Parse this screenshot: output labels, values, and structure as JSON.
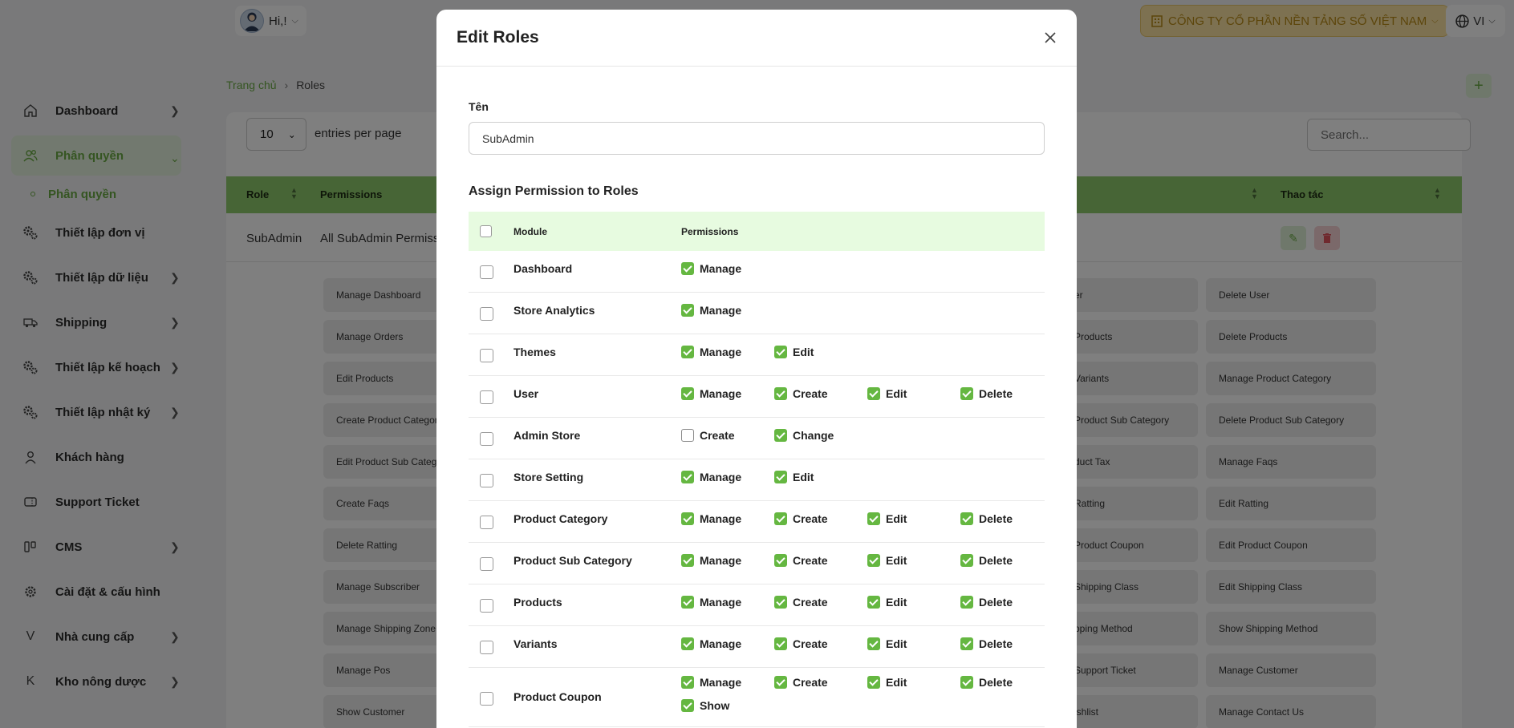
{
  "topbar": {
    "greeting": "Hi,!",
    "company": "CÔNG TY CỔ PHẦN NỀN TẢNG SỐ VIỆT NAM",
    "language": "VI"
  },
  "sidebar": {
    "items": [
      {
        "label": "Dashboard",
        "icon": "home-icon",
        "chevron": true
      },
      {
        "label": "Phân quyền",
        "icon": "users-icon",
        "chevron": true,
        "active": true
      },
      {
        "label": "Thiết lập đơn vị",
        "icon": "gears-icon",
        "chevron": false
      },
      {
        "label": "Thiết lập dữ liệu",
        "icon": "gears-icon",
        "chevron": true
      },
      {
        "label": "Shipping",
        "icon": "truck-icon",
        "chevron": true
      },
      {
        "label": "Thiết lập kế hoạch",
        "icon": "gears-icon",
        "chevron": true
      },
      {
        "label": "Thiết lập nhật ký",
        "icon": "gears-icon",
        "chevron": true
      },
      {
        "label": "Khách hàng",
        "icon": "user-icon",
        "chevron": false
      },
      {
        "label": "Support Ticket",
        "icon": "ticket-icon",
        "chevron": false
      },
      {
        "label": "CMS",
        "icon": "cms-icon",
        "chevron": true
      },
      {
        "label": "Cài đặt & cấu hình",
        "icon": "gear-icon",
        "chevron": false
      },
      {
        "label": "Nhà cung cấp",
        "icon": "v-icon",
        "chevron": true
      },
      {
        "label": "Kho nông dược",
        "icon": "k-icon",
        "chevron": true
      }
    ],
    "sub_item": "Phân quyền"
  },
  "breadcrumb": {
    "home": "Trang chủ",
    "sep": "›",
    "current": "Roles"
  },
  "list": {
    "entries_value": "10",
    "entries_label": "entries per page",
    "search_placeholder": "Search...",
    "headers": {
      "role": "Role",
      "permissions": "Permissions",
      "actions": "Thao tác"
    },
    "row": {
      "role": "SubAdmin",
      "permissions": "All SubAdmin Permissio"
    },
    "chips_left": [
      "Manage Dashboard",
      "Manage Orders",
      "Edit Products",
      "Create Product Categor",
      "Edit Product Sub Categ",
      "Create Faqs",
      "Delete Ratting",
      "Manage Subscriber",
      "Manage Shipping Zone",
      "Manage Pos",
      "Show Customer"
    ],
    "chips_mid": [
      "er",
      "Products",
      "Variants",
      "Product Sub Category",
      "duct Tax",
      "Ratting",
      "Product Coupon",
      "Shipping Class",
      "pping Method",
      "Support Ticket",
      "ishlist"
    ],
    "chips_right": [
      "Delete User",
      "Delete Products",
      "Manage Product Category",
      "Delete Product Sub Category",
      "Manage Faqs",
      "Edit Ratting",
      "Edit Product Coupon",
      "Edit Shipping Class",
      "Show Shipping Method",
      "Manage Customer",
      "Manage Contact Us"
    ]
  },
  "modal": {
    "title": "Edit Roles",
    "name_label": "Tên",
    "name_value": "SubAdmin",
    "section_title": "Assign Permission to Roles",
    "col_module": "Module",
    "col_permissions": "Permissions",
    "rows": [
      {
        "module": "Dashboard",
        "perms": [
          {
            "label": "Manage",
            "checked": true
          }
        ]
      },
      {
        "module": "Store Analytics",
        "perms": [
          {
            "label": "Manage",
            "checked": true
          }
        ]
      },
      {
        "module": "Themes",
        "perms": [
          {
            "label": "Manage",
            "checked": true
          },
          {
            "label": "Edit",
            "checked": true
          }
        ]
      },
      {
        "module": "User",
        "perms": [
          {
            "label": "Manage",
            "checked": true
          },
          {
            "label": "Create",
            "checked": true
          },
          {
            "label": "Edit",
            "checked": true
          },
          {
            "label": "Delete",
            "checked": true
          }
        ]
      },
      {
        "module": "Admin Store",
        "perms": [
          {
            "label": "Create",
            "checked": false
          },
          {
            "label": "Change",
            "checked": true
          }
        ]
      },
      {
        "module": "Store Setting",
        "perms": [
          {
            "label": "Manage",
            "checked": true
          },
          {
            "label": "Edit",
            "checked": true
          }
        ]
      },
      {
        "module": "Product Category",
        "perms": [
          {
            "label": "Manage",
            "checked": true
          },
          {
            "label": "Create",
            "checked": true
          },
          {
            "label": "Edit",
            "checked": true
          },
          {
            "label": "Delete",
            "checked": true
          }
        ]
      },
      {
        "module": "Product Sub Category",
        "perms": [
          {
            "label": "Manage",
            "checked": true
          },
          {
            "label": "Create",
            "checked": true
          },
          {
            "label": "Edit",
            "checked": true
          },
          {
            "label": "Delete",
            "checked": true
          }
        ]
      },
      {
        "module": "Products",
        "perms": [
          {
            "label": "Manage",
            "checked": true
          },
          {
            "label": "Create",
            "checked": true
          },
          {
            "label": "Edit",
            "checked": true
          },
          {
            "label": "Delete",
            "checked": true
          }
        ]
      },
      {
        "module": "Variants",
        "perms": [
          {
            "label": "Manage",
            "checked": true
          },
          {
            "label": "Create",
            "checked": true
          },
          {
            "label": "Edit",
            "checked": true
          },
          {
            "label": "Delete",
            "checked": true
          }
        ]
      },
      {
        "module": "Product Coupon",
        "perms": [
          {
            "label": "Manage",
            "checked": true
          },
          {
            "label": "Create",
            "checked": true
          },
          {
            "label": "Edit",
            "checked": true
          },
          {
            "label": "Delete",
            "checked": true
          },
          {
            "label": "Show",
            "checked": true
          }
        ]
      }
    ]
  },
  "colors": {
    "accent": "#6aab44",
    "check": "#65b741",
    "header_green": "#8fcb6c",
    "perm_head_bg": "#e7fbe0"
  }
}
